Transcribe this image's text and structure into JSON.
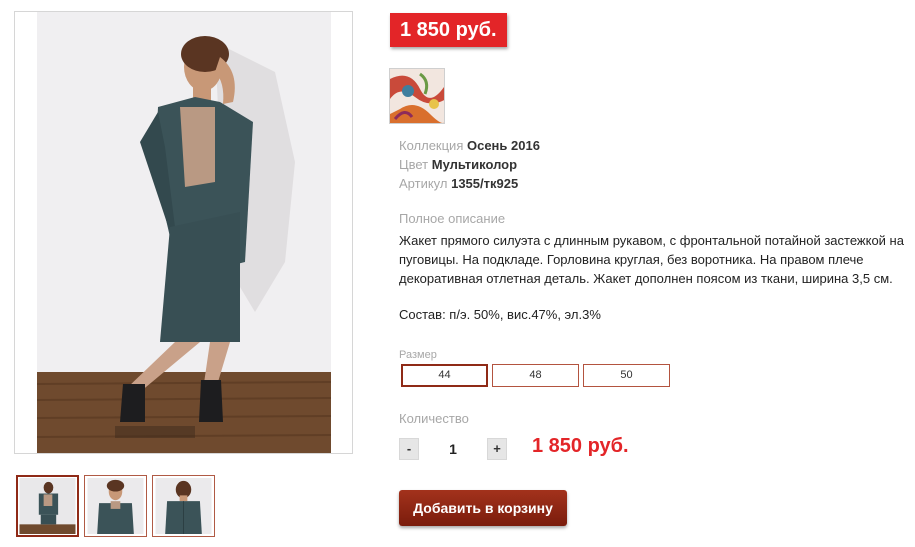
{
  "price_badge": "1 850 руб.",
  "props": {
    "collection_label": "Коллекция",
    "collection_value": "Осень 2016",
    "color_label": "Цвет",
    "color_value": "Мультиколор",
    "article_label": "Артикул",
    "article_value": "1355/тк925"
  },
  "description": {
    "title": "Полное описание",
    "text": "Жакет прямого силуэта с длинным рукавом, с фронтальной потайной застежкой на пуговицы. На подкладе. Горловина круглая, без воротника. На правом плече декоративная отлетная деталь. Жакет дополнен поясом из ткани, ширина 3,5 см.",
    "composition": "Состав: п/э. 50%, вис.47%, эл.3%"
  },
  "size": {
    "label": "Размер",
    "options": [
      "44",
      "48",
      "50"
    ],
    "selected": "44"
  },
  "quantity": {
    "label": "Количество",
    "minus": "-",
    "plus": "+",
    "value": "1"
  },
  "total_price": "1 850 руб.",
  "add_to_cart": "Добавить в корзину",
  "colors": {
    "price_red": "#e32528",
    "button_dark_red": "#8f2a17"
  }
}
